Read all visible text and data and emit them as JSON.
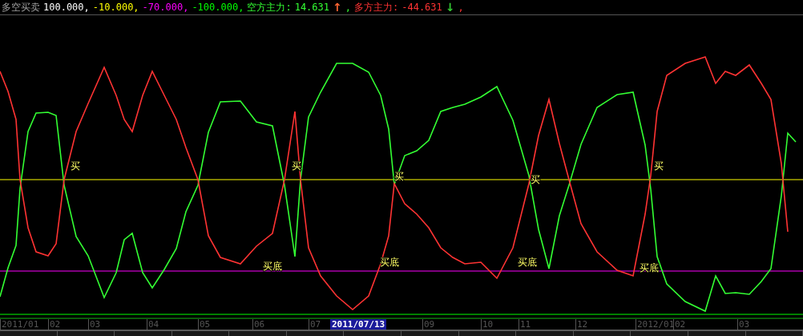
{
  "indicator_title": "多空买卖",
  "levels": [
    {
      "text": "100.000,",
      "color": "#ffffff"
    },
    {
      "text": "-10.000,",
      "color": "#ffff00"
    },
    {
      "text": "-70.000,",
      "color": "#ff00ff"
    },
    {
      "text": "-100.000,",
      "color": "#00ff00"
    }
  ],
  "forces": [
    {
      "name": "空方主力:",
      "value": "14.631",
      "arrow": {
        "glyph": "↑",
        "color": "#ff6633"
      },
      "color": "#33ff33",
      "separator": ","
    },
    {
      "name": "多方主力:",
      "value": "-44.631",
      "arrow": {
        "glyph": "↓",
        "color": "#33cc33"
      },
      "color": "#ff3333",
      "separator": ","
    }
  ],
  "signals": [
    {
      "label": "买"
    },
    {
      "label": "买底"
    },
    {
      "label": "买"
    },
    {
      "label": "买底"
    },
    {
      "label": "买"
    },
    {
      "label": "买底"
    },
    {
      "label": "买"
    },
    {
      "label": "买底"
    },
    {
      "label": "买"
    }
  ],
  "date_axis": [
    {
      "label": "2011/01",
      "kind": "tick"
    },
    {
      "label": "02",
      "kind": "tick"
    },
    {
      "label": "03",
      "kind": "tick"
    },
    {
      "label": "04",
      "kind": "tick"
    },
    {
      "label": "05",
      "kind": "tick"
    },
    {
      "label": "06",
      "kind": "tick"
    },
    {
      "label": "07",
      "kind": "tick"
    },
    {
      "label": "2011/07/13",
      "kind": "cursor"
    },
    {
      "label": "09",
      "kind": "tick"
    },
    {
      "label": "10",
      "kind": "tick"
    },
    {
      "label": "11",
      "kind": "tick"
    },
    {
      "label": "12",
      "kind": "tick"
    },
    {
      "label": "2012/01",
      "kind": "tick"
    },
    {
      "label": "02",
      "kind": "tick"
    },
    {
      "label": "03",
      "kind": "tick"
    }
  ]
}
